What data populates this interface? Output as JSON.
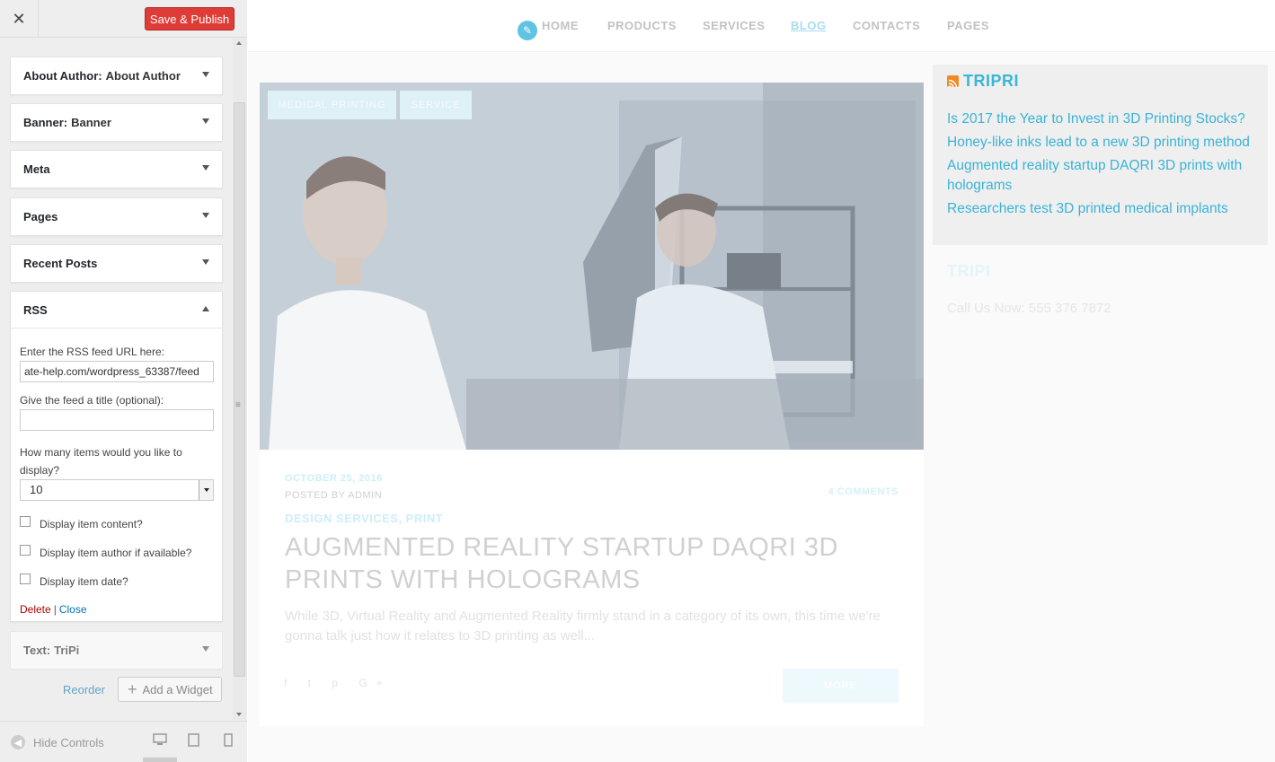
{
  "panel": {
    "close_symbol": "✕",
    "save_label": "Save & Publish",
    "widgets": [
      {
        "title": "About Author:",
        "subtitle": "About Author"
      },
      {
        "title": "Banner:",
        "subtitle": "Banner"
      },
      {
        "title": "Meta",
        "subtitle": ""
      },
      {
        "title": "Pages",
        "subtitle": ""
      },
      {
        "title": "Recent Posts",
        "subtitle": ""
      }
    ],
    "rss": {
      "title": "RSS",
      "url_label": "Enter the RSS feed URL here:",
      "url_value": "ate-help.com/wordpress_63387/feed",
      "feed_title_label": "Give the feed a title (optional):",
      "feed_title_value": "",
      "items_label": "How many items would you like to display?",
      "items_value": "10",
      "check_content": "Display item content?",
      "check_author": "Display item author if available?",
      "check_date": "Display item date?",
      "delete_label": "Delete",
      "separator": "|",
      "close_label": "Close"
    },
    "text_widget": {
      "title": "Text:",
      "subtitle": "TriPi"
    },
    "reorder_label": "Reorder",
    "add_widget_label": "Add a Widget",
    "hide_controls_label": "Hide Controls"
  },
  "preview": {
    "nav": [
      "HOME",
      "PRODUCTS",
      "SERVICES",
      "BLOG",
      "CONTACTS",
      "PAGES"
    ],
    "active_nav": "BLOG",
    "post": {
      "tags": [
        "MEDICAL PRINTING",
        "SERVICE"
      ],
      "date": "OCTOBER 25, 2016",
      "author": "POSTED BY ADMIN",
      "comments": "4 COMMENTS",
      "categories": "DESIGN SERVICES, PRINT",
      "title": "AUGMENTED REALITY STARTUP DAQRI 3D PRINTS WITH HOLOGRAMS",
      "excerpt": "While 3D, Virtual Reality and Augmented Reality firmly stand in a category of its own, this time we're gonna talk just how it relates to 3D printing as well...",
      "social": "f  t  p  G+",
      "more_label": "MORE"
    },
    "sidebar": {
      "rss_title": "TRIPRI",
      "rss_items": [
        "Is 2017 the Year to Invest in 3D Printing Stocks?",
        "Honey-like inks lead to a new 3D printing method",
        "Augmented reality startup DAQRI 3D prints with holograms",
        "Researchers test 3D printed medical implants"
      ],
      "text_title": "TRIPI",
      "text_body": "Call Us Now: 555 376 7872"
    }
  },
  "colors": {
    "save_button": "#dd3d36",
    "link_blue": "#3bb5d8",
    "rss_orange": "#f08a24"
  }
}
